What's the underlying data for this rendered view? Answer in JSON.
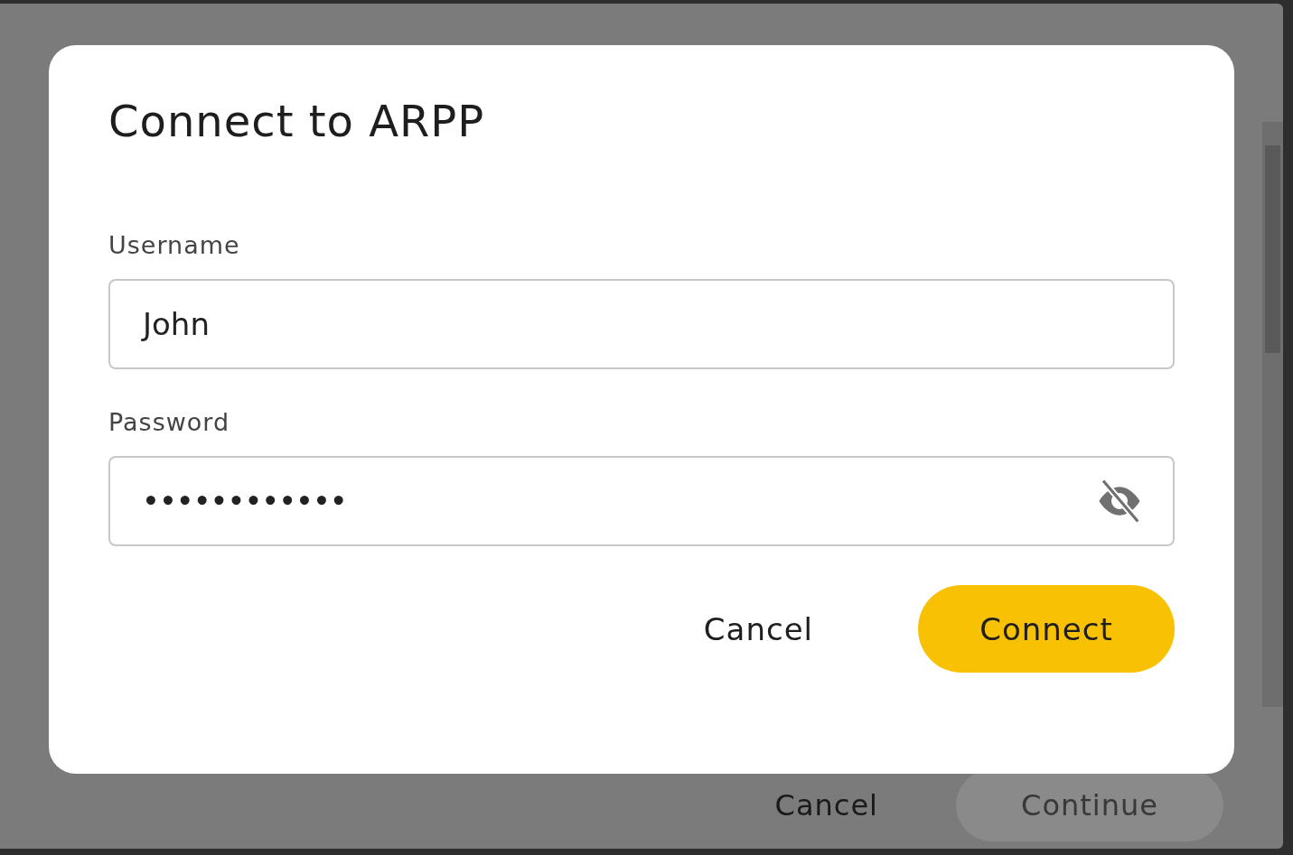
{
  "background_dialog": {
    "buttons": [
      {
        "label": "Cancel",
        "kind": "text",
        "disabled": false
      },
      {
        "label": "Continue",
        "kind": "filled",
        "disabled": true
      }
    ]
  },
  "dialog": {
    "title": "Connect to ARPP",
    "fields": [
      {
        "label": "Username",
        "value": "John",
        "kind": "text"
      },
      {
        "label": "Password",
        "value": "••••••••••••",
        "kind": "password"
      }
    ],
    "buttons": [
      {
        "label": "Cancel",
        "kind": "text"
      },
      {
        "label": "Connect",
        "kind": "filled"
      }
    ]
  }
}
